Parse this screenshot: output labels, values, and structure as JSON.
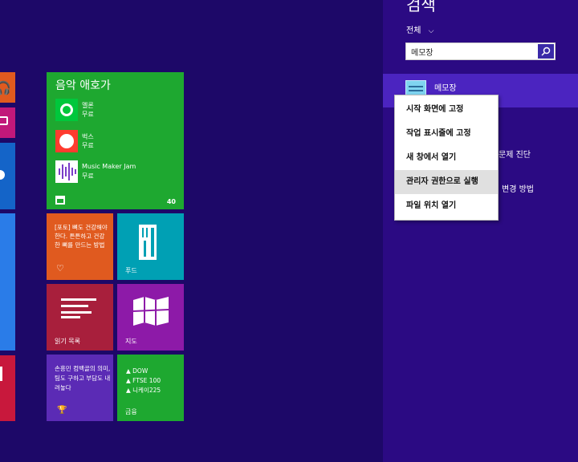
{
  "music_tile": {
    "title": "음악 애호가",
    "apps": [
      {
        "name": "멜론",
        "price": "무료"
      },
      {
        "name": "벅스",
        "price": "무료"
      },
      {
        "name": "Music Maker Jam",
        "price": "무료"
      }
    ],
    "count": "40"
  },
  "health_tile": {
    "text": "[포토] 뼈도 건강해야한다. 튼튼하고 건강한 뼈를 만드는 방법"
  },
  "food_tile": {
    "label": "푸드"
  },
  "reading_tile": {
    "label": "읽기 목록"
  },
  "maps_tile": {
    "label": "지도"
  },
  "sports_tile": {
    "text": "손흥민 컴백골의 의미, 팀도 구하고 부담도 내려놓다"
  },
  "finance_tile": {
    "items": [
      "DOW",
      "FTSE 100",
      "니케이225"
    ],
    "label": "금융"
  },
  "search": {
    "title": "검색",
    "scope": "전체",
    "query": "메모장",
    "result": "메모장",
    "partial_1": "문제 진단",
    "partial_2": "변경 방법"
  },
  "context_menu": {
    "items": [
      "시작 화면에 고정",
      "작업 표시줄에 고정",
      "새 창에서 열기",
      "관리자 권한으로 실행",
      "파일 위치 열기"
    ],
    "highlighted": 3
  },
  "colors": {
    "bg": "#1d0868",
    "panel": "#2b0a83",
    "music": "#1ea830",
    "health": "#e05a1f",
    "food": "#00a0b4",
    "reading": "#a81f3c",
    "maps": "#8d1aa8",
    "sports": "#5b2bb5",
    "finance": "#1ea830"
  }
}
